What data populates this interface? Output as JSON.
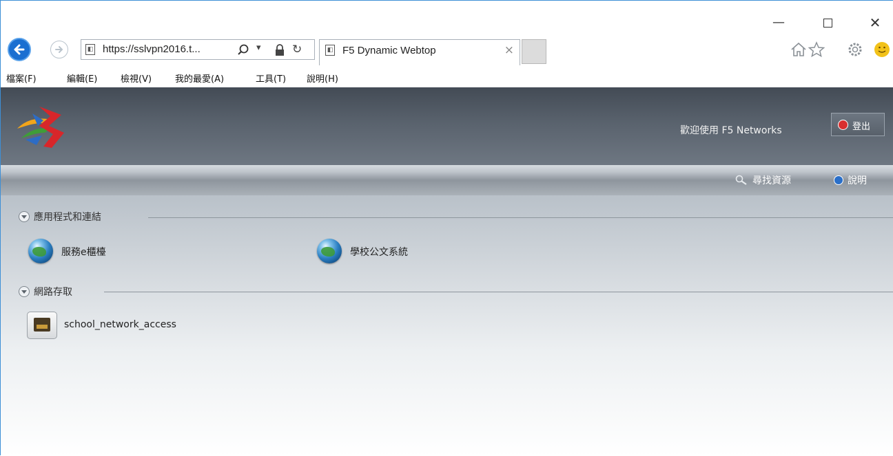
{
  "browser": {
    "address_url": "https://sslvpn2016.t...",
    "tab_title": "F5 Dynamic Webtop",
    "tab_close": "×",
    "window_controls": {
      "minimize": "—",
      "close": "✕"
    },
    "menu": [
      "檔案(F)",
      "編輯(E)",
      "檢視(V)",
      "我的最愛(A)",
      "工具(T)",
      "說明(H)"
    ],
    "icons": [
      "back-arrow-icon",
      "forward-arrow-icon",
      "page-icon",
      "search-icon",
      "lock-icon",
      "refresh-icon",
      "home-icon",
      "favorites-star-icon",
      "gear-icon",
      "smiley-feedback-icon"
    ]
  },
  "webtop": {
    "welcome_text": "歡迎使用 F5 Networks",
    "logout_label": "登出",
    "toolbar": {
      "search_label": "尋找資源",
      "help_label": "說明"
    },
    "sections": [
      {
        "title": "應用程式和連結",
        "items": [
          {
            "label": "服務e櫃檯",
            "icon": "globe-icon"
          },
          {
            "label": "學校公文系統",
            "icon": "globe-icon"
          }
        ]
      },
      {
        "title": "網路存取",
        "items": [
          {
            "label": "school_network_access",
            "icon": "network-access-icon"
          }
        ]
      }
    ]
  }
}
